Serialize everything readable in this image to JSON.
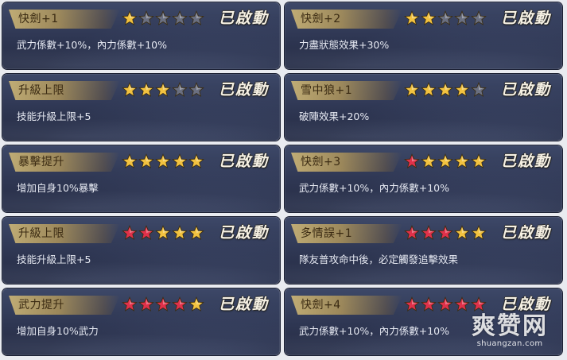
{
  "status_text": "已啟動",
  "cards": [
    {
      "title": "快劍+1",
      "gold": 1,
      "red": 0,
      "effect": "武力係數+10%，內力係數+10%"
    },
    {
      "title": "快劍+2",
      "gold": 2,
      "red": 0,
      "effect": "力盡狀態效果+30%"
    },
    {
      "title": "升級上限",
      "gold": 3,
      "red": 0,
      "effect": "技能升級上限+5"
    },
    {
      "title": "雪中狼+1",
      "gold": 4,
      "red": 0,
      "effect": "破陣效果+20%"
    },
    {
      "title": "暴擊提升",
      "gold": 5,
      "red": 0,
      "effect": "增加自身10%暴擊"
    },
    {
      "title": "快劍+3",
      "gold": 4,
      "red": 1,
      "effect": "武力係數+10%，內力係數+10%"
    },
    {
      "title": "升級上限",
      "gold": 3,
      "red": 2,
      "effect": "技能升級上限+5"
    },
    {
      "title": "多情誤+1",
      "gold": 2,
      "red": 3,
      "effect": "隊友普攻命中後，必定觸發追擊效果"
    },
    {
      "title": "武力提升",
      "gold": 1,
      "red": 4,
      "effect": "增加自身10%武力"
    },
    {
      "title": "快劍+4",
      "gold": 0,
      "red": 5,
      "effect": "武力係數+10%，內力係數+10%"
    }
  ],
  "max_stars": 5,
  "colors": {
    "gold_star": "#f2c240",
    "red_star": "#e0314a",
    "empty_star": "#6a6f80"
  },
  "watermark": {
    "main": "爽赞网",
    "sub": "shuangzan.com"
  }
}
